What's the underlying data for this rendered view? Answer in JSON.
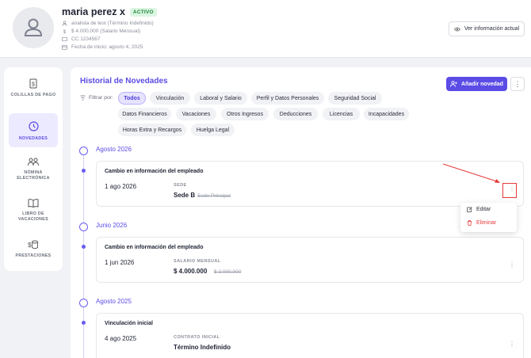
{
  "employee": {
    "name": "maria perez x",
    "status": "ACTIVO",
    "role": "analista de test (Término Indefinido)",
    "salary": "$ 4.000.000 (Salario Mensual)",
    "id_doc": "CC 1234567",
    "start_date": "Fecha de inicio: agosto 4, 2025"
  },
  "header": {
    "view_info_label": "Ver información actual"
  },
  "sidebar": {
    "items": [
      {
        "label": "COLILLAS DE PAGO",
        "icon": "receipt-icon"
      },
      {
        "label": "NOVEDADES",
        "icon": "history-icon"
      },
      {
        "label": "NÓMINA ELECTRÓNICA",
        "icon": "users-icon"
      },
      {
        "label": "LIBRO DE VACACIONES",
        "icon": "book-icon"
      },
      {
        "label": "PRESTACIONES",
        "icon": "coins-icon"
      }
    ]
  },
  "main": {
    "title": "Historial de Novedades",
    "add_label": "Añadir novedad",
    "filter_label": "Filtrar por:",
    "filters": [
      "Todos",
      "Vinculación",
      "Laboral y Salario",
      "Perfil y Datos Personales",
      "Seguridad Social",
      "Datos Financieros",
      "Vacaciones",
      "Otros Ingresos",
      "Deducciones",
      "Licencias",
      "Incapacidades",
      "Horas Extra y Recargos",
      "Huelga Legal"
    ],
    "active_filter": "Todos"
  },
  "timeline": [
    {
      "month": "Agosto 2026",
      "title": "Cambio en información del empleado",
      "date": "1 ago 2026",
      "field_label": "SEDE",
      "new_value": "Sede B",
      "old_value": "Sede Principal"
    },
    {
      "month": "Junio 2026",
      "title": "Cambio en información del empleado",
      "date": "1 jun 2026",
      "field_label": "SALARIO MENSUAL",
      "new_value": "$ 4.000.000",
      "old_value": "$ 2.000.000"
    },
    {
      "month": "Agosto 2025",
      "title": "Vinculación inicial",
      "date": "4 ago 2025",
      "field_label": "CONTRATO INICIAL",
      "new_value": "Término Indefinido",
      "old_value": ""
    }
  ],
  "context_menu": {
    "edit_label": "Editar",
    "delete_label": "Eliminar"
  },
  "colors": {
    "accent": "#5b4ce6",
    "danger": "#e53b3b",
    "success": "#1d8a3c"
  }
}
